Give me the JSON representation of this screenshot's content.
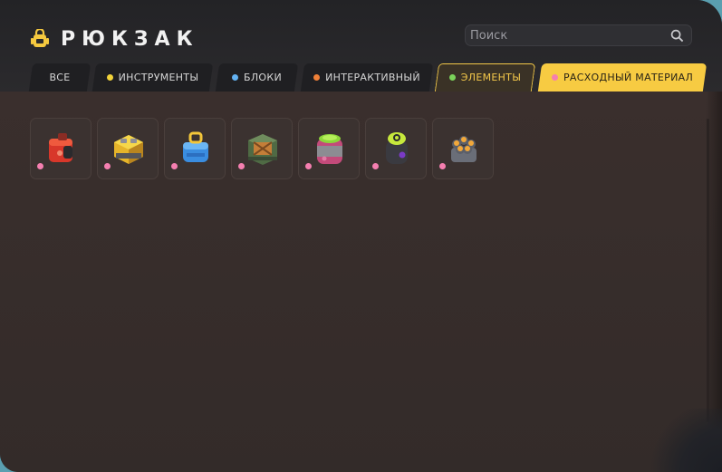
{
  "header": {
    "title": "РЮКЗАК",
    "icon": "backpack-icon",
    "accent": "#f5c93f"
  },
  "search": {
    "placeholder": "Поиск",
    "value": ""
  },
  "tabs": [
    {
      "label": "ВСЕ",
      "dot": null
    },
    {
      "label": "ИНСТРУМЕНТЫ",
      "dot": "#f2d33a"
    },
    {
      "label": "БЛОКИ",
      "dot": "#63b2f2"
    },
    {
      "label": "ИНТЕРАКТИВНЫЙ",
      "dot": "#f08038"
    },
    {
      "label": "ЭЛЕМЕНТЫ",
      "dot": "#7bd25a"
    },
    {
      "label": "РАСХОДНЫЙ МАТЕРИАЛ",
      "dot": "#f57fb0"
    }
  ],
  "items": [
    {
      "icon": "red-fuel-canister-icon",
      "rarity_color": "#f57fb0"
    },
    {
      "icon": "yellow-battery-box-icon",
      "rarity_color": "#f57fb0"
    },
    {
      "icon": "blue-water-tank-icon",
      "rarity_color": "#f57fb0"
    },
    {
      "icon": "green-supply-crate-icon",
      "rarity_color": "#f57fb0"
    },
    {
      "icon": "pink-chemical-canister-icon",
      "rarity_color": "#f57fb0"
    },
    {
      "icon": "green-gas-cylinder-icon",
      "rarity_color": "#f57fb0"
    },
    {
      "icon": "ammo-cluster-icon",
      "rarity_color": "#f57fb0"
    }
  ]
}
